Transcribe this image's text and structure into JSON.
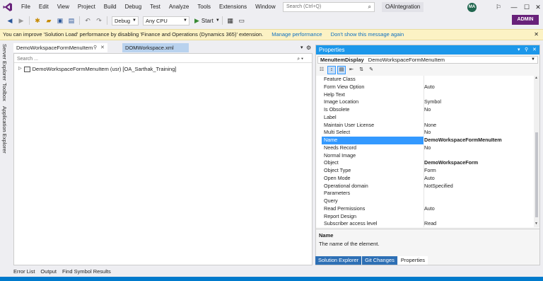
{
  "menu": [
    "File",
    "Edit",
    "View",
    "Project",
    "Build",
    "Debug",
    "Test",
    "Analyze",
    "Tools",
    "Extensions",
    "Window",
    "Help"
  ],
  "search": {
    "placeholder": "Search (Ctrl+Q)"
  },
  "solution_name": "OAIntegration",
  "avatar_initials": "MA",
  "toolbar": {
    "configuration": "Debug",
    "platform": "Any CPU",
    "start_label": "Start",
    "admin_label": "ADMIN"
  },
  "infobar": {
    "message": "You can improve 'Solution Load' performance by disabling 'Finance and Operations (Dynamics 365)' extension.",
    "link1": "Manage performance",
    "link2": "Don't show this message again"
  },
  "left_tool_tabs": [
    "Server Explorer",
    "Toolbox",
    "Application Explorer"
  ],
  "doc_tabs": [
    {
      "label": "DemoWorkspaceFormMenuItem"
    },
    {
      "label": "DOMWorkspace.xml"
    }
  ],
  "doc": {
    "search_placeholder": "Search ...",
    "tree_item": "DemoWorkspaceFormMenuItem (usr) [OA_Sarthak_Training]"
  },
  "properties": {
    "title": "Properties",
    "object_name": "MenuItemDisplay",
    "object_type": "DemoWorkspaceFormMenuItem",
    "rows": [
      {
        "name": "Feature Class",
        "value": ""
      },
      {
        "name": "Form View Option",
        "value": "Auto"
      },
      {
        "name": "Help Text",
        "value": ""
      },
      {
        "name": "Image Location",
        "value": "Symbol"
      },
      {
        "name": "Is Obsolete",
        "value": "No"
      },
      {
        "name": "Label",
        "value": ""
      },
      {
        "name": "Maintain User License",
        "value": "None"
      },
      {
        "name": "Multi Select",
        "value": "No"
      },
      {
        "name": "Name",
        "value": "DemoWorkspaceFormMenuItem",
        "bold": true,
        "selected": true
      },
      {
        "name": "Needs Record",
        "value": "No"
      },
      {
        "name": "Normal Image",
        "value": ""
      },
      {
        "name": "Object",
        "value": "DemoWorkspaceForm",
        "bold": true
      },
      {
        "name": "Object Type",
        "value": "Form"
      },
      {
        "name": "Open Mode",
        "value": "Auto"
      },
      {
        "name": "Operational domain",
        "value": "NotSpecified"
      },
      {
        "name": "Parameters",
        "value": ""
      },
      {
        "name": "Query",
        "value": ""
      },
      {
        "name": "Read Permissions",
        "value": "Auto"
      },
      {
        "name": "Report Design",
        "value": ""
      },
      {
        "name": "Subscriber access level",
        "value": "Read"
      }
    ],
    "description_name": "Name",
    "description_text": "The name of the element."
  },
  "panel_tabs": [
    "Solution Explorer",
    "Git Changes",
    "Properties"
  ],
  "bottom_tool_tabs": [
    "Error List",
    "Output",
    "Find Symbol Results"
  ],
  "colors": {
    "accent": "#1c97ea",
    "admin": "#68217a",
    "status": "#007acc",
    "selection": "#3399ff"
  }
}
